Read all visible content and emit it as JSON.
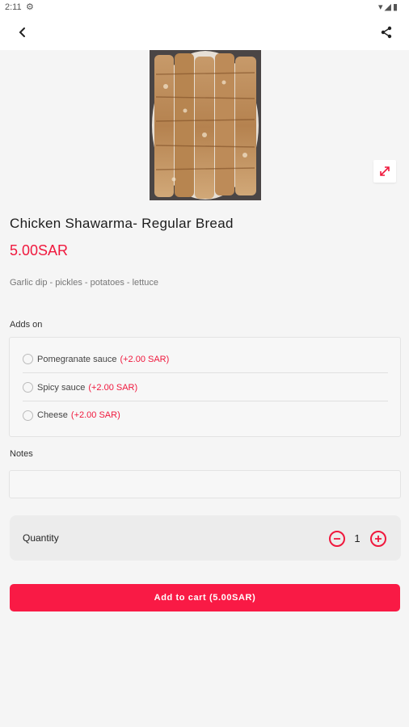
{
  "status_bar": {
    "time": "2:11",
    "icons": [
      "wifi-icon",
      "signal-icon",
      "battery-icon"
    ]
  },
  "app_bar": {
    "back_icon": "chevron-left-icon",
    "share_icon": "share-icon"
  },
  "product": {
    "title": "Chicken Shawarma- Regular Bread",
    "price": "5.00SAR",
    "description": "Garlic dip - pickles - potatoes - lettuce"
  },
  "addons": {
    "label": "Adds on",
    "items": [
      {
        "name": "Pomegranate sauce",
        "price": "(+2.00 SAR)"
      },
      {
        "name": "Spicy sauce",
        "price": "(+2.00 SAR)"
      },
      {
        "name": "Cheese",
        "price": "(+2.00 SAR)"
      }
    ]
  },
  "notes": {
    "label": "Notes",
    "value": "",
    "placeholder": ""
  },
  "quantity": {
    "label": "Quantity",
    "value": "1"
  },
  "cart_button": {
    "label": "Add to cart (5.00SAR)"
  },
  "colors": {
    "accent": "#f91a45",
    "price": "#f0183d",
    "background": "#f5f5f5"
  }
}
